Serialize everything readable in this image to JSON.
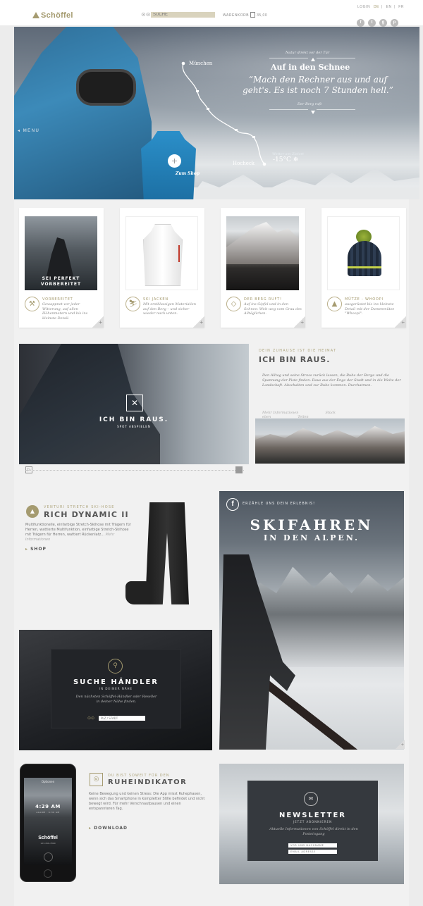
{
  "header": {
    "brand": "Schöffel",
    "search_placeholder": "SUCHE",
    "cart_label": "WARENKORB",
    "cart_total": "35,00",
    "top_links": [
      "LOGIN",
      "DE",
      "EN",
      "FR"
    ],
    "social_icons": [
      "facebook-icon",
      "twitter-icon",
      "googleplus-icon",
      "pinterest-icon"
    ]
  },
  "hero": {
    "menu_label": "MENU",
    "kicker": "Natur direkt vor der Tür",
    "title": "Auf in den Schnee",
    "quote": "“Mach den Rechner aus und auf geht's. Es ist noch 7 Stunden hell.”",
    "subline": "Der Berg ruft",
    "route_start": "München",
    "route_end": "Hocheck",
    "weather_label": "Wetter am Zielort",
    "temperature": "-15°C",
    "shop_label": "Zum Shop",
    "accent": "#a59b70"
  },
  "cards": [
    {
      "overlay_line1": "SEI PERFEKT",
      "overlay_line2": "VORBEREITET",
      "title": "VORBEREITET",
      "text": "Gewappnet vor jeder Witterung, auf allen Höhenmetern und bis ins kleinste Detail.",
      "icon": "tool-icon"
    },
    {
      "title": "SKI JACKEN",
      "text": "Mit erstklassigen Materialien auf den Berg – und sicher wieder nach unten.",
      "icon": "ski-icon"
    },
    {
      "title": "DER BERG RUFT!",
      "text": "Auf ins Gipfel und in den Schnee: Weit weg vom Grau des Alltäglichen.",
      "icon": "mountain-icon"
    },
    {
      "title": "MÜTZE - WHOOPI",
      "text": "ausgerüstet bis ins kleinste Detail mit der Damenmütze \"Whoopi\".",
      "icon": "mountain-icon"
    }
  ],
  "raus": {
    "title": "ICH BIN RAUS.",
    "subtitle": "SPOT ABSPIELEN",
    "kicker": "DEIN ZUHAUSE IST DIE HEIMAT",
    "heading": "ICH BIN RAUS.",
    "text": "Den Alltag und seine Stress zurück lassen, die Ruhe der Berge und die Spannung der Piste finden. Raus aus der Enge der Stadt und in die Weite der Landschaft. Abschalten und zur Ruhe kommen. Durchatmen.",
    "links": [
      "Mehr Informationen",
      "Stück eben",
      "Teilen"
    ]
  },
  "rich_dynamic": {
    "kicker": "VENTURI STRETCH SKI-HOSE",
    "title": "RICH DYNAMIC II",
    "text": "Multifunktionelle, einfarbige Stretch-Skihose mit Trägern für Herren, wattierte Multifunktion, einfarbige Stretch-Skihose mit Trägern für Herren, wattiert Rückenlatz...",
    "more": "Mehr Informationen",
    "shop": "SHOP"
  },
  "ski": {
    "kicker": "ERZÄHLE UNS DEIN ERLEBNIS!",
    "title": "SKIFAHREN",
    "subtitle": "IN DEN ALPEN."
  },
  "dealer": {
    "title": "SUCHE HÄNDLER",
    "subtitle": "IN DEINER NÄHE",
    "text": "Den nächsten Schöffel-Händler oder Reseller in deiner Nähe finden.",
    "input_placeholder": "PLZ / STADT"
  },
  "ruhe": {
    "kicker": "DU BIST SOWEIT FÜR DEN",
    "title": "RUHEINDIKATOR",
    "text": "Keine Bewegung und keinen Stress: Die App misst Ruhephasen, wenn sich das Smartphone in kompletter Stille befindet und nicht bewegt wird. Für mehr Verschnaufpausen und einen entspannteren Tag.",
    "download": "DOWNLOAD",
    "phone_label": "Optionen",
    "phone_time": "4:29 AM",
    "phone_alarm": "ALARM · 6:30 AM",
    "phone_brand": "Schöffel",
    "phone_number": "123-456-7890"
  },
  "newsletter": {
    "title": "NEWSLETTER",
    "subtitle": "JETZT ABONNIEREN",
    "text": "Aktuelle Informationen von Schöffel direkt in den Posteingang",
    "name_placeholder": "VOR UND NACHNAME",
    "email_placeholder": "EMAIL ADRESSE"
  }
}
